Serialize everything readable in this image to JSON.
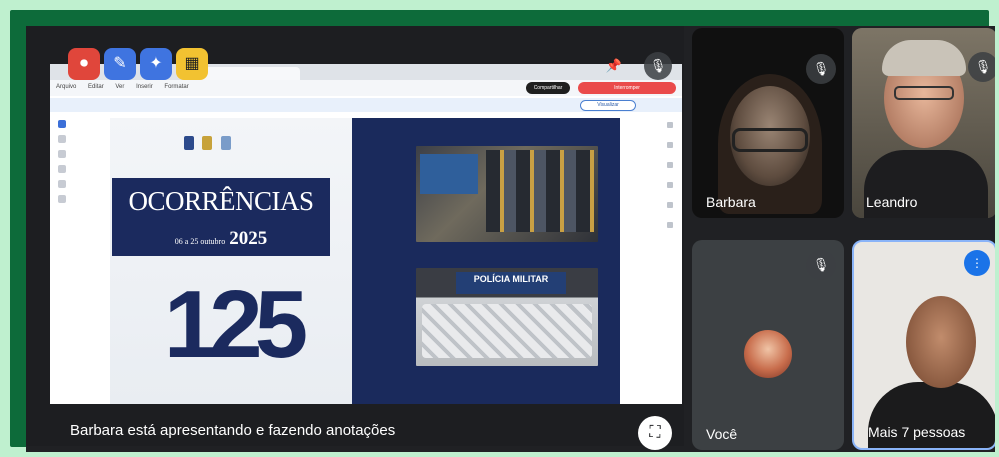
{
  "presentation": {
    "caption": "Barbara está apresentando e fazendo anotações",
    "controls": [
      {
        "name": "record-icon",
        "glyph": "⏺"
      },
      {
        "name": "pen-icon",
        "glyph": "✎"
      },
      {
        "name": "magic-wand-icon",
        "glyph": "✦"
      },
      {
        "name": "video-off-icon",
        "glyph": "▦"
      }
    ],
    "pin_glyph": "📌",
    "mic_off_glyph": "🎙",
    "fullscreen_glyph": "⛶",
    "browser": {
      "menu_items": [
        "Arquivo",
        "Editar",
        "Ver",
        "Inserir",
        "Formatar"
      ],
      "share_label": "Compartilhar",
      "stop_label": "Interromper",
      "view_label": "Visualizar"
    },
    "slide": {
      "title": "OCORRÊNCIAS",
      "date_range": "06 a 25 outubro",
      "year": "2025",
      "count": "125",
      "photo2_banner": "POLÍCIA MILITAR"
    }
  },
  "participants": [
    {
      "name": "Barbara",
      "muted": true
    },
    {
      "name": "Leandro",
      "muted": true
    },
    {
      "name": "Você",
      "muted": true
    },
    {
      "name": "Mais 7 pessoas",
      "speaking": true
    }
  ],
  "colors": {
    "frame": "#0d6b3a",
    "outer_background": "#bff0cf",
    "meet_background": "#202124",
    "slide_navy": "#1b2a5e",
    "stop_red": "#ea4b4b",
    "speaking_blue": "#1a73e8"
  }
}
